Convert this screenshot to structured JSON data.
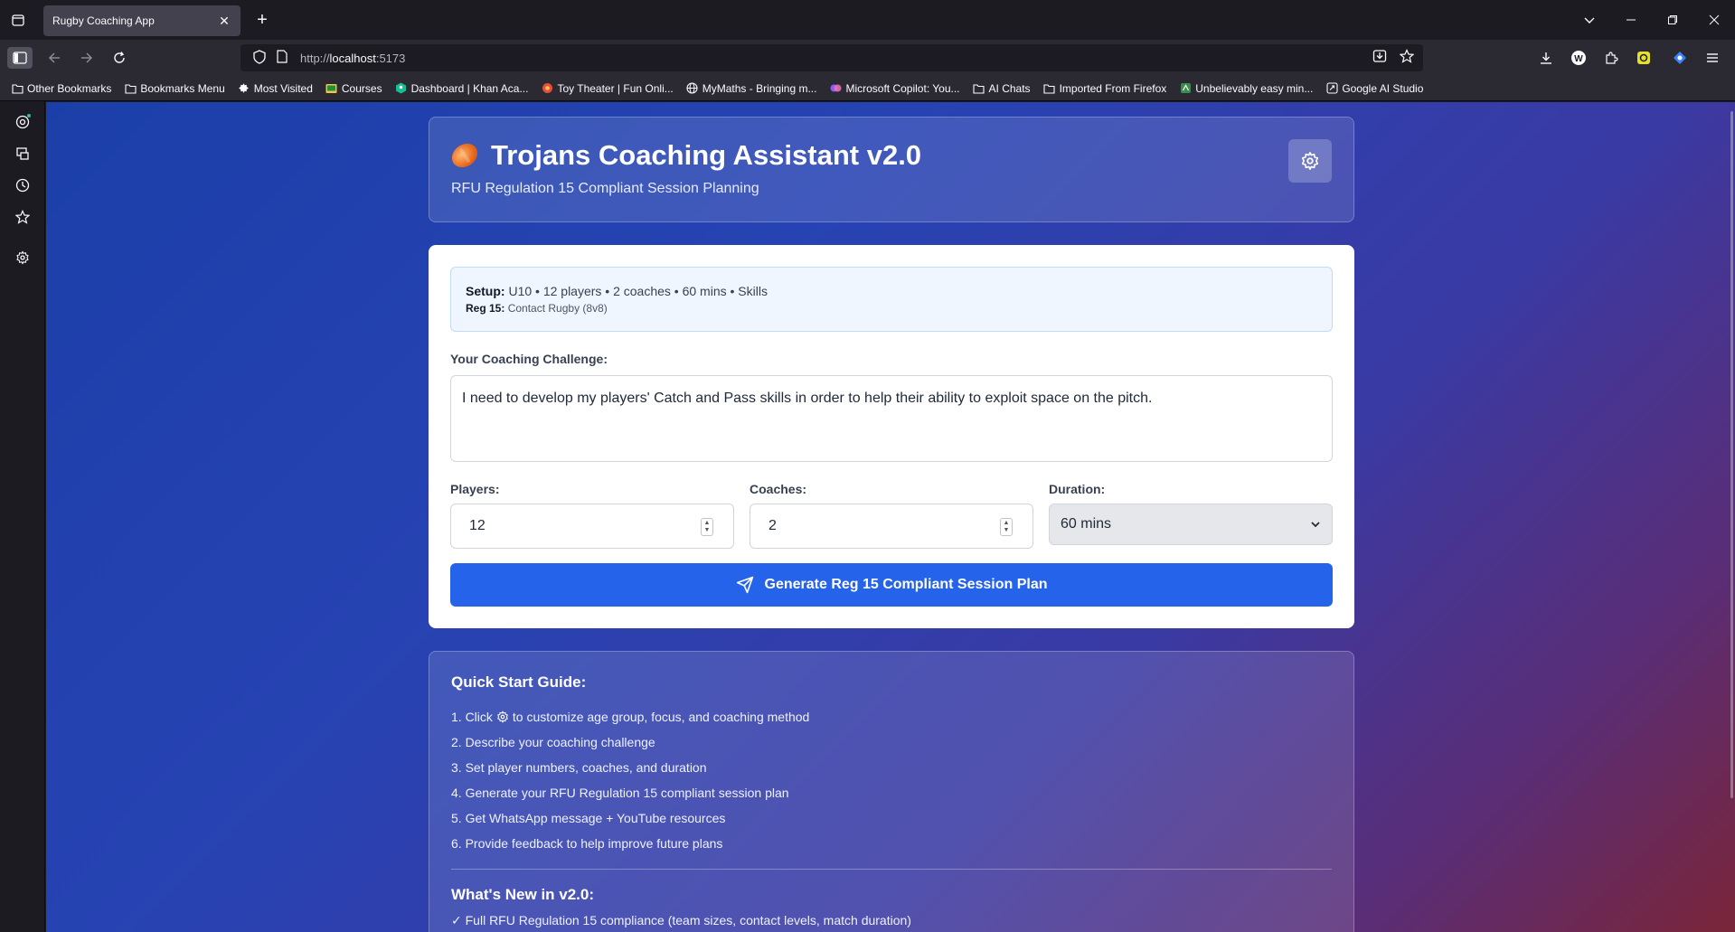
{
  "browser": {
    "tab_title": "Rugby Coaching App",
    "url_prefix": "http://",
    "url_host": "localhost",
    "url_port": ":5173",
    "bookmarks": [
      {
        "label": "Other Bookmarks",
        "icon": "folder-icon"
      },
      {
        "label": "Bookmarks Menu",
        "icon": "folder-icon"
      },
      {
        "label": "Most Visited",
        "icon": "gear-icon"
      },
      {
        "label": "Courses",
        "icon": "classroom-icon"
      },
      {
        "label": "Dashboard | Khan Aca...",
        "icon": "khan-icon"
      },
      {
        "label": "Toy Theater | Fun Onli...",
        "icon": "toy-theater-icon"
      },
      {
        "label": "MyMaths - Bringing m...",
        "icon": "globe-icon"
      },
      {
        "label": "Microsoft Copilot: You...",
        "icon": "copilot-icon"
      },
      {
        "label": "AI Chats",
        "icon": "folder-icon"
      },
      {
        "label": "Imported From Firefox",
        "icon": "folder-icon"
      },
      {
        "label": "Unbelievably easy min...",
        "icon": "site-icon"
      },
      {
        "label": "Google AI Studio",
        "icon": "ai-studio-icon"
      }
    ]
  },
  "header": {
    "title": "Trojans Coaching Assistant v2.0",
    "subtitle": "RFU Regulation 15 Compliant Session Planning"
  },
  "setup": {
    "label": "Setup:",
    "summary": "U10 • 12 players • 2 coaches • 60 mins • Skills",
    "reg_label": "Reg 15:",
    "reg_value": "Contact Rugby (8v8)"
  },
  "form": {
    "challenge_label": "Your Coaching Challenge:",
    "challenge_value": "I need to develop my players' Catch and Pass skills in order to help their ability to exploit space on the pitch.",
    "players_label": "Players:",
    "players_value": "12",
    "coaches_label": "Coaches:",
    "coaches_value": "2",
    "duration_label": "Duration:",
    "duration_value": "60 mins",
    "generate_label": "Generate Reg 15 Compliant Session Plan"
  },
  "guide": {
    "title": "Quick Start Guide:",
    "step1_pre": "1. Click",
    "step1_post": "to customize age group, focus, and coaching method",
    "steps": [
      "2. Describe your coaching challenge",
      "3. Set player numbers, coaches, and duration",
      "4. Generate your RFU Regulation 15 compliant session plan",
      "5. Get WhatsApp message + YouTube resources",
      "6. Provide feedback to help improve future plans"
    ],
    "whats_new_title": "What's New in v2.0:",
    "whats_new": [
      "✓ Full RFU Regulation 15 compliance (team sizes, contact levels, match duration)"
    ]
  },
  "colors": {
    "primary_button": "#2563eb",
    "setup_bg": "#eff6ff"
  }
}
